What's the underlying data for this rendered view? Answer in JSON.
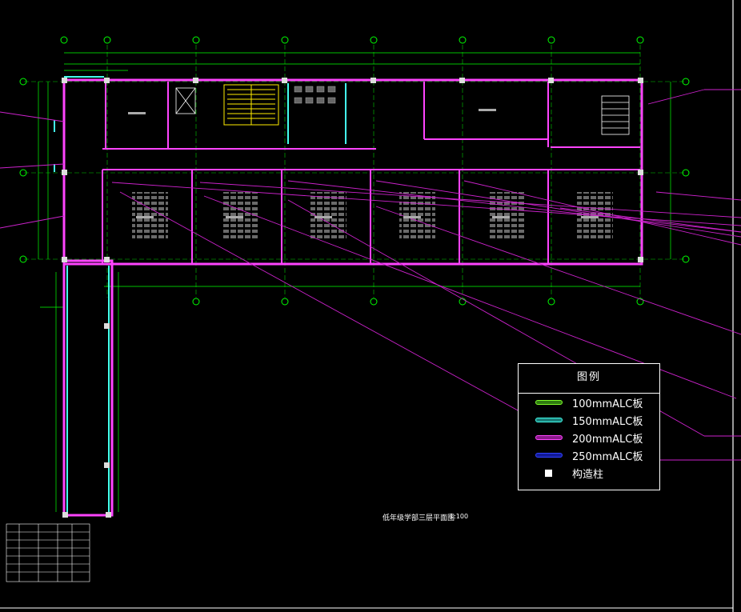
{
  "legend": {
    "title": "图例",
    "items": [
      {
        "label": "100mmALC板",
        "color": "#7fff2a",
        "fill": "#2f7a10"
      },
      {
        "label": "150mmALC板",
        "color": "#44ffee",
        "fill": "#1a7f7a"
      },
      {
        "label": "200mmALC板",
        "color": "#ff44ff",
        "fill": "#8a1a8a"
      },
      {
        "label": "250mmALC板",
        "color": "#3344ff",
        "fill": "#121a9a"
      },
      {
        "label": "构造柱",
        "color": "#ffffff",
        "fill": "#ffffff"
      }
    ]
  },
  "drawing": {
    "title": "低年级学部三层平面图",
    "scale": "1:100"
  },
  "colors": {
    "background": "#000000",
    "axis": "#00ff00",
    "wall": "#ff44ff",
    "partition": "#44ffee",
    "leader": "#cc22cc",
    "stair": "#ffee00"
  }
}
